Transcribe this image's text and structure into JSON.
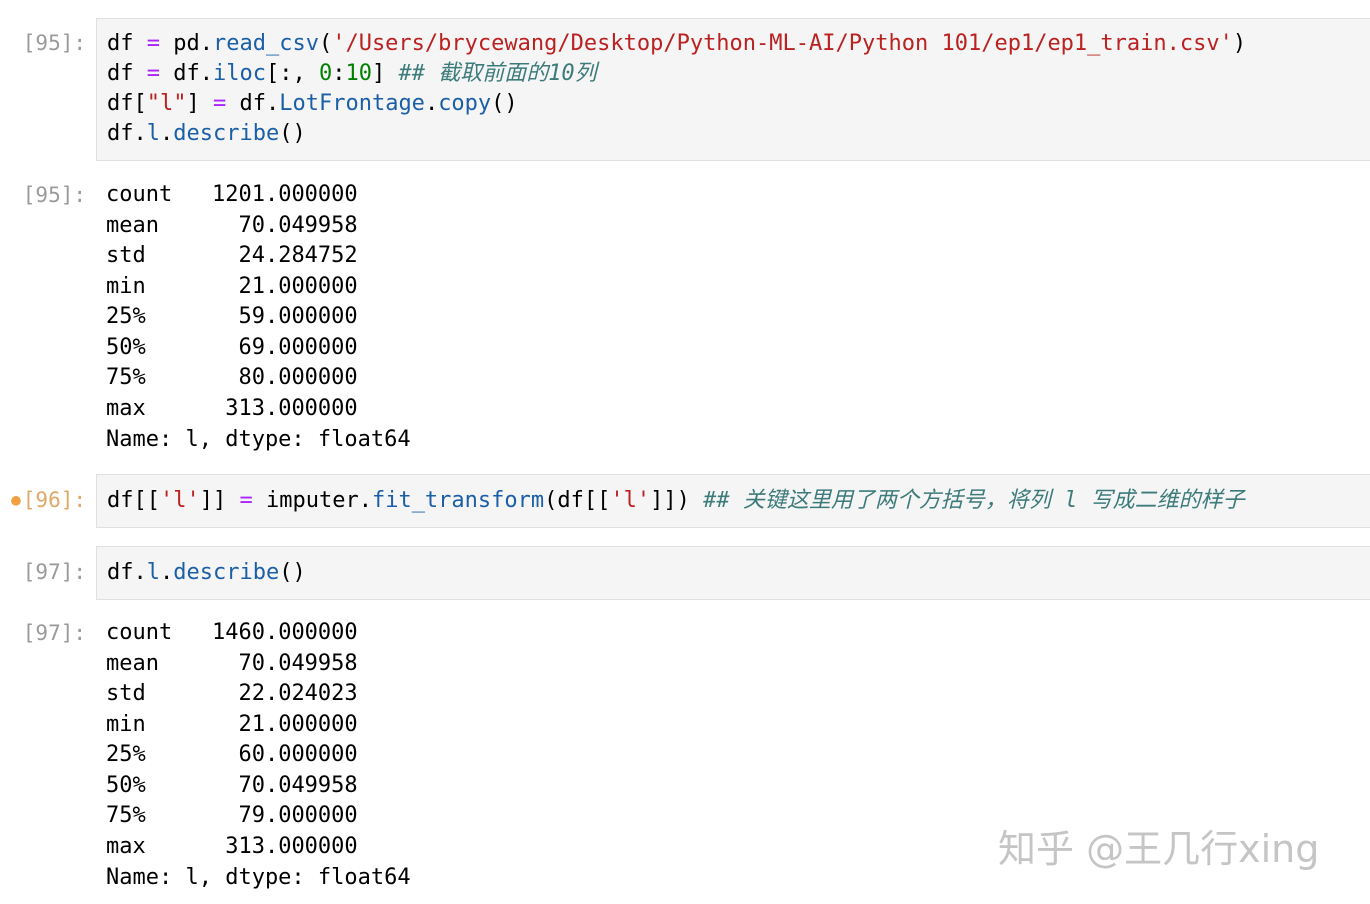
{
  "cells": [
    {
      "prompt": "[95]:",
      "code": {
        "line1": {
          "a": "df ",
          "op": "=",
          "b": " pd.",
          "fn": "read_csv",
          "c": "(",
          "str": "'/Users/brycewang/Desktop/Python-ML-AI/Python 101/ep1/ep1_train.csv'",
          "d": ")"
        },
        "line2": {
          "a": "df ",
          "op": "=",
          "b": " df.",
          "fn": "iloc",
          "c": "[:, ",
          "n1": "0",
          "colon": ":",
          "n2": "10",
          "d": "] ",
          "cmt": "## 截取前面的10列"
        },
        "line3": {
          "a": "df[",
          "str": "\"l\"",
          "b": "] ",
          "op": "=",
          "c": " df.",
          "fn1": "LotFrontage",
          "dot": ".",
          "fn2": "copy",
          "d": "()"
        },
        "line4": {
          "a": "df.",
          "fn1": "l",
          "dot": ".",
          "fn2": "describe",
          "d": "()"
        }
      }
    },
    {
      "prompt": "[96]:",
      "code": {
        "line1": {
          "a": "df[[",
          "str1": "'l'",
          "b": "]] ",
          "op": "=",
          "c": " imputer.",
          "fn": "fit_transform",
          "d": "(df[[",
          "str2": "'l'",
          "e": "]]) ",
          "cmt": "## 关键这里用了两个方括号，将列 l 写成二维的样子"
        }
      }
    },
    {
      "prompt": "[97]:",
      "code": {
        "line1": {
          "a": "df.",
          "fn1": "l",
          "dot": ".",
          "fn2": "describe",
          "d": "()"
        }
      }
    }
  ],
  "outputs": [
    {
      "prompt": "[95]:",
      "rows": [
        {
          "label": "count",
          "value": "1201.000000"
        },
        {
          "label": "mean",
          "value": "70.049958"
        },
        {
          "label": "std",
          "value": "24.284752"
        },
        {
          "label": "min",
          "value": "21.000000"
        },
        {
          "label": "25%",
          "value": "59.000000"
        },
        {
          "label": "50%",
          "value": "69.000000"
        },
        {
          "label": "75%",
          "value": "80.000000"
        },
        {
          "label": "max",
          "value": "313.000000"
        }
      ],
      "footer": "Name: l, dtype: float64"
    },
    {
      "prompt": "[97]:",
      "rows": [
        {
          "label": "count",
          "value": "1460.000000"
        },
        {
          "label": "mean",
          "value": "70.049958"
        },
        {
          "label": "std",
          "value": "22.024023"
        },
        {
          "label": "min",
          "value": "21.000000"
        },
        {
          "label": "25%",
          "value": "60.000000"
        },
        {
          "label": "50%",
          "value": "70.049958"
        },
        {
          "label": "75%",
          "value": "79.000000"
        },
        {
          "label": "max",
          "value": "313.000000"
        }
      ],
      "footer": "Name: l, dtype: float64"
    }
  ],
  "watermark": "知乎 @王几行xing"
}
